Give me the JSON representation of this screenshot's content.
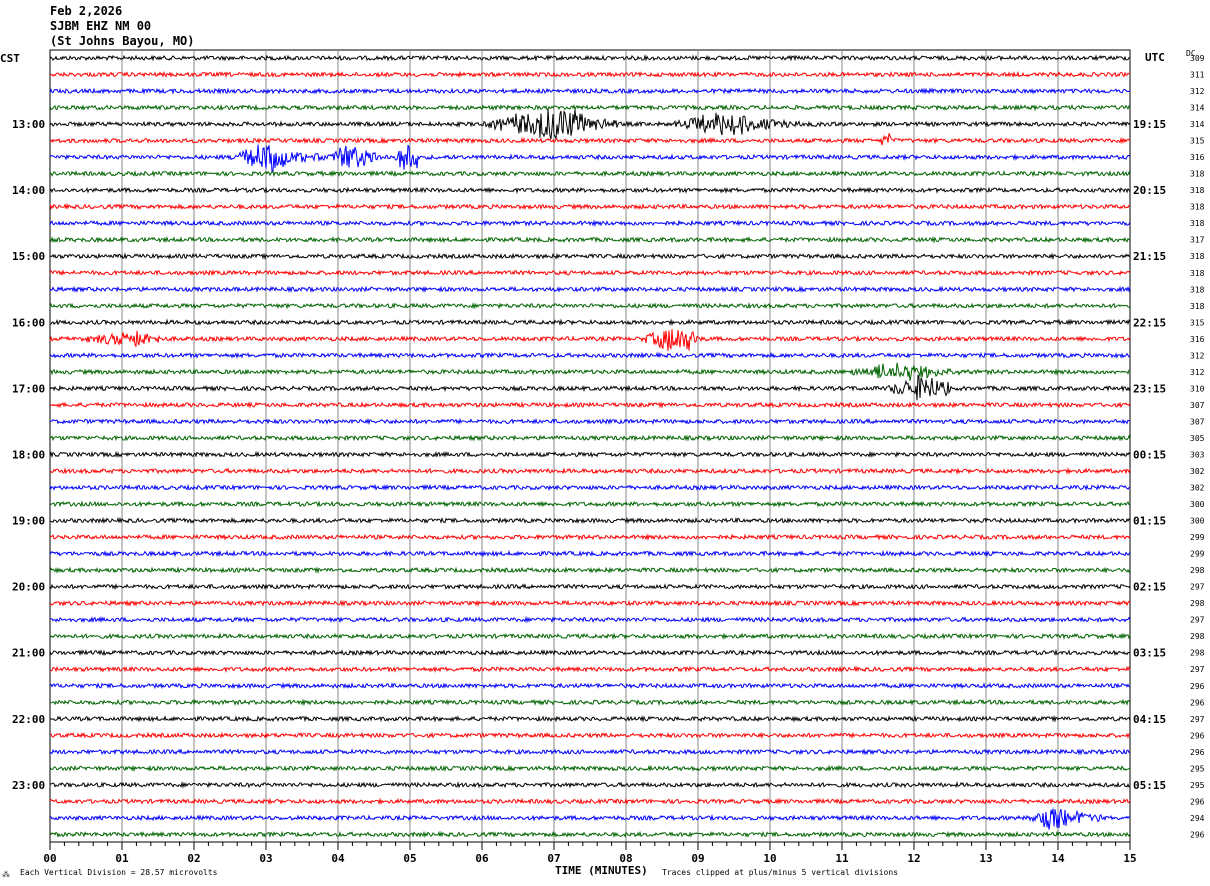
{
  "header": {
    "date": "Feb 2,2026",
    "station": "SJBM EHZ NM 00",
    "location": "(St Johns Bayou, MO)"
  },
  "left_tz": "CST",
  "right_tz": "UTC",
  "dc_label": "DC",
  "footer": {
    "scale": "Each Vertical Division =   28.57 microvolts",
    "xlabel": "TIME (MINUTES)",
    "clip": "Traces clipped at plus/minus 5 vertical divisions",
    "mark": "⁂"
  },
  "chart_data": {
    "type": "line",
    "title": "SJBM EHZ NM 00 helicorder Feb 2,2026",
    "xlabel": "TIME (MINUTES)",
    "xlim": [
      0,
      15
    ],
    "x_ticks": [
      "00",
      "01",
      "02",
      "03",
      "04",
      "05",
      "06",
      "07",
      "08",
      "09",
      "10",
      "11",
      "12",
      "13",
      "14",
      "15"
    ],
    "trace_colors": [
      "#000000",
      "#ff0000",
      "#0000ff",
      "#006400"
    ],
    "left_labels": [
      "CST",
      "",
      "",
      "",
      "13:00",
      "",
      "",
      "",
      "14:00",
      "",
      "",
      "",
      "15:00",
      "",
      "",
      "",
      "16:00",
      "",
      "",
      "",
      "17:00",
      "",
      "",
      "",
      "18:00",
      "",
      "",
      "",
      "19:00",
      "",
      "",
      "",
      "20:00",
      "",
      "",
      "",
      "21:00",
      "",
      "",
      "",
      "22:00",
      "",
      "",
      "",
      "23:00",
      "",
      "",
      ""
    ],
    "right_labels": [
      "",
      "",
      "",
      "",
      "19:15",
      "",
      "",
      "",
      "20:15",
      "",
      "",
      "",
      "21:15",
      "",
      "",
      "",
      "22:15",
      "",
      "",
      "",
      "23:15",
      "",
      "",
      "",
      "00:15",
      "",
      "",
      "",
      "01:15",
      "",
      "",
      "",
      "02:15",
      "",
      "",
      "",
      "03:15",
      "",
      "",
      "",
      "04:15",
      "",
      "",
      "",
      "05:15",
      "",
      "",
      ""
    ],
    "dc_values": [
      "309",
      "311",
      "312",
      "314",
      "314",
      "315",
      "316",
      "318",
      "318",
      "318",
      "318",
      "317",
      "318",
      "318",
      "318",
      "318",
      "315",
      "316",
      "312",
      "312",
      "310",
      "307",
      "307",
      "305",
      "303",
      "302",
      "302",
      "300",
      "300",
      "299",
      "299",
      "298",
      "297",
      "298",
      "297",
      "298",
      "298",
      "297",
      "296",
      "296",
      "297",
      "296",
      "296",
      "295",
      "295",
      "296",
      "294",
      "296"
    ],
    "events": [
      {
        "row": 4,
        "start": 6.0,
        "end": 7.9,
        "peak": 7.15,
        "amp": 4
      },
      {
        "row": 4,
        "start": 8.6,
        "end": 10.7,
        "peak": 9.5,
        "amp": 2.5
      },
      {
        "row": 6,
        "start": 2.5,
        "end": 5.7,
        "peak": 3.0,
        "amp": 3
      },
      {
        "row": 6,
        "start": 3.9,
        "end": 4.6,
        "peak": 4.1,
        "amp": 3
      },
      {
        "row": 6,
        "start": 4.8,
        "end": 5.1,
        "peak": 4.9,
        "amp": 4
      },
      {
        "row": 5,
        "start": 11.5,
        "end": 11.7,
        "peak": 11.6,
        "amp": 1.5
      },
      {
        "row": 17,
        "start": 0.4,
        "end": 1.6,
        "peak": 1.2,
        "amp": 1.5
      },
      {
        "row": 17,
        "start": 8.2,
        "end": 9.0,
        "peak": 8.7,
        "amp": 3
      },
      {
        "row": 19,
        "start": 11.0,
        "end": 12.8,
        "peak": 11.9,
        "amp": 1.8
      },
      {
        "row": 20,
        "start": 11.6,
        "end": 12.5,
        "peak": 12.1,
        "amp": 2.5
      },
      {
        "row": 46,
        "start": 13.6,
        "end": 14.6,
        "peak": 13.9,
        "amp": 3
      }
    ]
  }
}
